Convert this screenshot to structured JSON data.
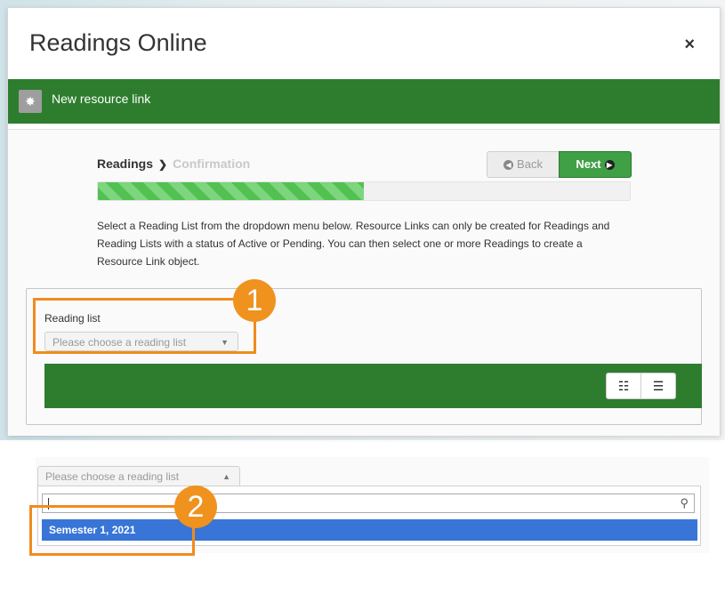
{
  "modal": {
    "title": "Readings Online",
    "close_icon": "×"
  },
  "green_bar": {
    "icon": "✸",
    "label": "New resource link"
  },
  "steps": {
    "current": "Readings",
    "separator": "❯",
    "next": "Confirmation"
  },
  "buttons": {
    "back": "Back",
    "back_icon": "◀",
    "next": "Next",
    "next_icon": "▶"
  },
  "progress": {
    "value_percent": 50
  },
  "description": "Select a Reading List from the dropdown menu below. Resource Links can only be created for Readings and Reading Lists with a status of Active or Pending. You can then select one or more Readings to create a Resource Link object.",
  "reading_list": {
    "label": "Reading list",
    "placeholder": "Please choose a reading list",
    "arrow_down": "▼",
    "arrow_up": "▲"
  },
  "view_toggle": {
    "grid_icon": "☷",
    "list_icon": "☰"
  },
  "callouts": {
    "one": "1",
    "two": "2"
  },
  "dropdown": {
    "search_icon": "⚲",
    "options": [
      "Semester 1, 2021"
    ]
  },
  "colors": {
    "brand_green": "#2e7d2e",
    "next_green": "#3fa046",
    "callout_orange": "#f08c1e",
    "selected_blue": "#3875d7"
  }
}
